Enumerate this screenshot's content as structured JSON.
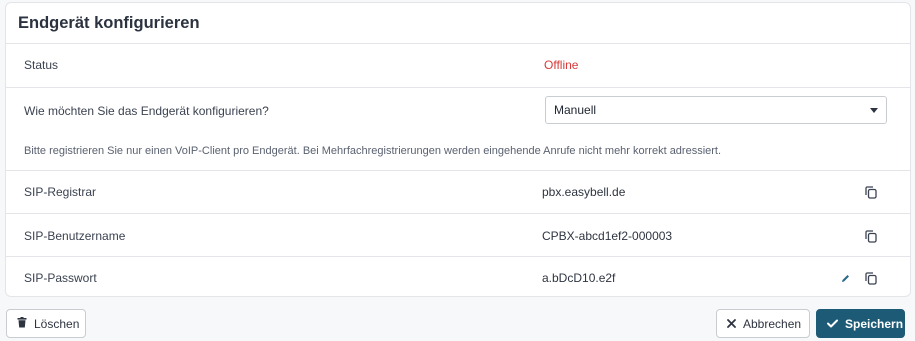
{
  "card": {
    "title": "Endgerät konfigurieren"
  },
  "status": {
    "label": "Status",
    "value": "Offline",
    "value_color": "#d93a3a"
  },
  "config": {
    "question": "Wie möchten Sie das Endgerät konfigurieren?",
    "selected": "Manuell",
    "hint": "Bitte registrieren Sie nur einen VoIP-Client pro Endgerät. Bei Mehrfachregistrierungen werden eingehende Anrufe nicht mehr korrekt adressiert."
  },
  "sip": {
    "registrar_label": "SIP-Registrar",
    "registrar_value": "pbx.easybell.de",
    "username_label": "SIP-Benutzername",
    "username_value": "CPBX-abcd1ef2-000003",
    "password_label": "SIP-Passwort",
    "password_value": "a.bDcD10.e2f"
  },
  "icons": {
    "copy": "copy-icon",
    "edit": "pencil-icon",
    "delete": "trash-icon",
    "cancel": "close-icon",
    "save": "check-icon",
    "dropdown": "caret-down-icon"
  },
  "buttons": {
    "delete_label": "Löschen",
    "cancel_label": "Abbrechen",
    "save_label": "Speichern"
  },
  "colors": {
    "primary": "#1c5a76",
    "status_offline": "#d93a3a",
    "edit_icon": "#2a6a8a"
  }
}
